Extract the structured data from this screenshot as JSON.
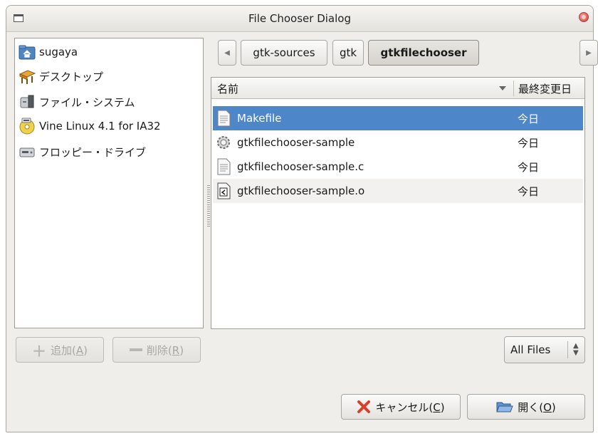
{
  "window": {
    "title": "File Chooser Dialog"
  },
  "places": [
    {
      "label": "sugaya",
      "icon": "home-folder-icon"
    },
    {
      "label": "デスクトップ",
      "icon": "desktop-icon"
    },
    {
      "label": "ファイル・システム",
      "icon": "filesystem-icon"
    },
    {
      "label": "Vine Linux 4.1 for IA32",
      "icon": "cdrom-icon"
    },
    {
      "label": "フロッピー・ドライブ",
      "icon": "floppy-drive-icon"
    }
  ],
  "pathbar": {
    "segments": [
      "gtk-sources",
      "gtk",
      "gtkfilechooser"
    ],
    "active": "gtkfilechooser"
  },
  "filelist": {
    "columns": {
      "name": "名前",
      "modified": "最終変更日"
    },
    "rows": [
      {
        "name": "Makefile",
        "modified": "今日",
        "icon": "text-file-icon",
        "selected": true
      },
      {
        "name": "gtkfilechooser-sample",
        "modified": "今日",
        "icon": "executable-gear-icon",
        "selected": false
      },
      {
        "name": "gtkfilechooser-sample.c",
        "modified": "今日",
        "icon": "text-file-icon",
        "selected": false
      },
      {
        "name": "gtkfilechooser-sample.o",
        "modified": "今日",
        "icon": "object-file-icon",
        "selected": false
      }
    ]
  },
  "buttons": {
    "add": {
      "text": "追加(",
      "mnemonic": "A",
      "close": ")"
    },
    "remove": {
      "text": "削除(",
      "mnemonic": "R",
      "close": ")"
    },
    "cancel": {
      "text": "キャンセル(",
      "mnemonic": "C",
      "close": ")"
    },
    "open": {
      "text": "開く(",
      "mnemonic": "O",
      "close": ")"
    }
  },
  "filter": {
    "selected": "All Files"
  },
  "colors": {
    "selection": "#4d86c9",
    "window_bg": "#efeeeb"
  }
}
